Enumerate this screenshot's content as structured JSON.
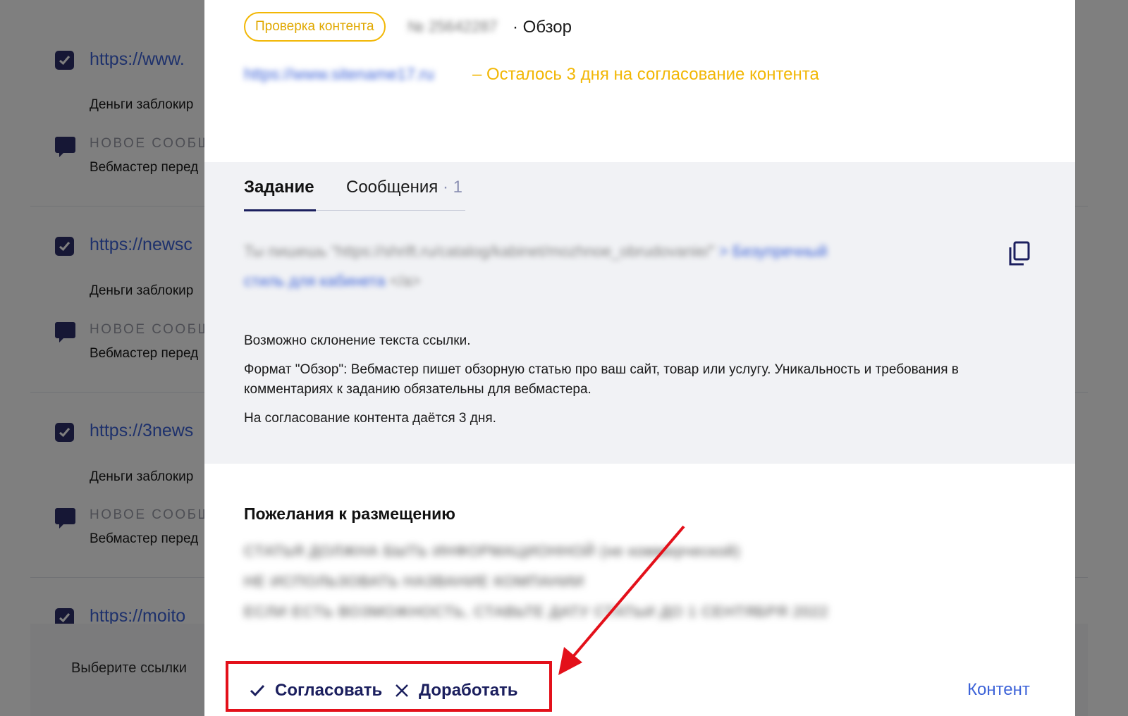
{
  "background": {
    "items": [
      {
        "link": "https://www.",
        "status": "Деньги заблокир",
        "label": "НОВОЕ СООБЩ",
        "message": "Вебмастер перед"
      },
      {
        "link": "https://newsc",
        "status": "Деньги заблокир",
        "label": "НОВОЕ СООБЩ",
        "message": "Вебмастер перед"
      },
      {
        "link": "https://3news",
        "status": "Деньги заблокир",
        "label": "НОВОЕ СООБЩ",
        "message": "Вебмастер перед"
      },
      {
        "link": "https://moito"
      }
    ],
    "footer_text": "Выберите ссылки"
  },
  "modal": {
    "badge": "Проверка контента",
    "order_id": "№ 25642287",
    "format": "· Обзор",
    "site_url": "https://www.sitename17.ru",
    "deadline": "– Осталось 3 дня на согласование контента",
    "tabs": {
      "task": "Задание",
      "messages": "Сообщения",
      "messages_count": "· 1"
    },
    "anchor": {
      "line1_muted": "Ты пишешь “",
      "line1_url": "https://shrift.ru/catalog/kabinet/mozhnoe_obrudovanie/”",
      "line1_text": "> Безупречный",
      "line2_text": "стиль для кабинета",
      "line2_end": "</a>"
    },
    "task_notes": [
      "Возможно склонение текста ссылки.",
      "Формат \"Обзор\": Вебмастер пишет обзорную статью про ваш сайт, товар или услугу. Уникальность и требования в комментариях к заданию обязательны для вебмастера.",
      "На согласование контента даётся 3 дня."
    ],
    "wishes_title": "Пожелания к размещению",
    "wishes": [
      "СТАТЬЯ ДОЛЖНА БЫТЬ ИНФОРМАЦИОННОЙ (не коммерческой)",
      "НЕ ИСПОЛЬЗОВАТЬ НАЗВАНИЕ КОМПАНИИ",
      "ЕСЛИ ЕСТЬ ВОЗМОЖНОСТЬ, СТАВЬТЕ ДАТУ СТАТЬИ ДО 1 СЕНТЯБРЯ 2022"
    ],
    "actions": {
      "approve": "Согласовать",
      "rework": "Доработать",
      "content": "Контент"
    }
  },
  "colors": {
    "accent_yellow": "#f2b705",
    "brand_dark": "#1b1f5e",
    "link_blue": "#3d63d8",
    "annotation_red": "#e3101a"
  }
}
